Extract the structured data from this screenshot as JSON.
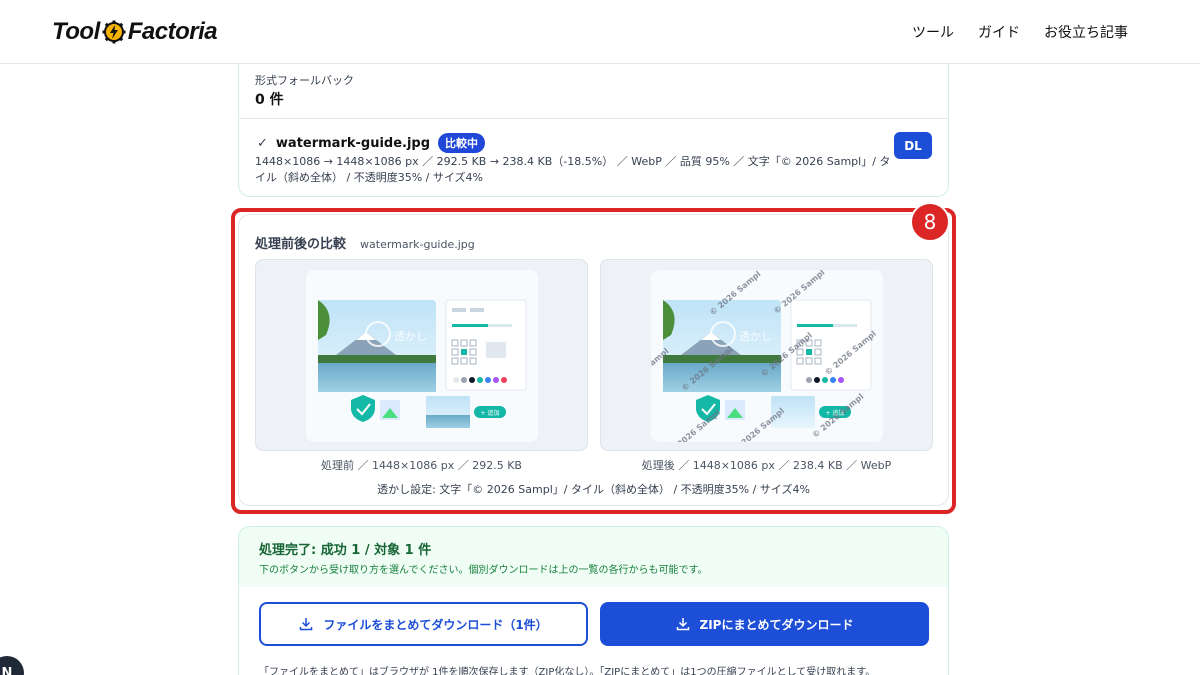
{
  "header": {
    "logo_text_left": "Tool",
    "logo_text_right": "Factoria",
    "nav": [
      "ツール",
      "ガイド",
      "お役立ち記事"
    ]
  },
  "results": {
    "fallback_label": "形式フォールバック",
    "fallback_count": "0 件",
    "file": {
      "check": "✓",
      "name": "watermark-guide.jpg",
      "badge": "比較中",
      "meta": "1448×1086 → 1448×1086 px ／ 292.5 KB → 238.4 KB（-18.5%） ／ WebP ／ 品質 95% ／ 文字「© 2026 Sampl」/ タイル（斜め全体） / 不透明度35% / サイズ4%",
      "dl_label": "DL"
    }
  },
  "compare": {
    "step_number": "8",
    "title": "処理前後の比較",
    "file_name": "watermark-guide.jpg",
    "before_caption": "処理前 ／ 1448×1086 px ／ 292.5 KB",
    "after_caption": "処理後 ／ 1448×1086 px ／ 238.4 KB ／ WebP",
    "watermark_settings": "透かし設定: 文字「© 2026 Sampl」/ タイル（斜め全体） / 不透明度35% / サイズ4%",
    "watermark_tile_text": "© 2026 Sampl",
    "preview_label": "透かし",
    "preview_add_button": "+ 追加"
  },
  "complete": {
    "title": "処理完了: 成功 1 / 対象 1 件",
    "subtitle": "下のボタンから受け取り方を選んでください。個別ダウンロードは上の一覧の各行からも可能です。",
    "btn_files": "ファイルをまとめてダウンロード（1件）",
    "btn_zip": "ZIPにまとめてダウンロード",
    "note": "「ファイルをまとめて」はブラウザが 1件を順次保存します（ZIP化なし）。「ZIPにまとめて」は1つの圧縮ファイルとして受け取れます。"
  },
  "corner_avatar_letter": "N",
  "colors": {
    "primary": "#1d4ed8",
    "highlight": "#dc2626",
    "success": "#166534",
    "success_bg": "#f0fdf4"
  }
}
